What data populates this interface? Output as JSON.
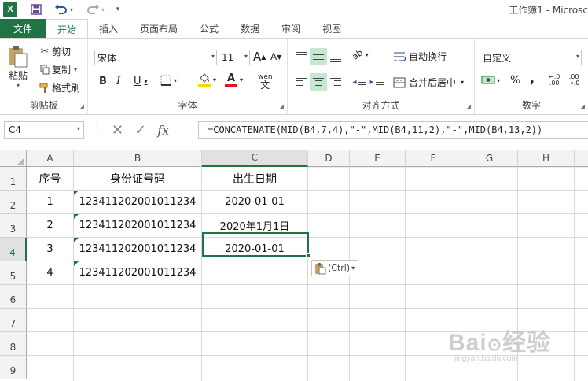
{
  "window": {
    "title": "工作簿1 - Microsc"
  },
  "quick_access": {
    "save_icon": "save-icon",
    "undo_icon": "undo-icon",
    "redo_icon": "redo-icon",
    "customize": "▾"
  },
  "tabs": [
    "文件",
    "开始",
    "插入",
    "页面布局",
    "公式",
    "数据",
    "审阅",
    "视图"
  ],
  "ribbon": {
    "clipboard": {
      "paste": "粘贴",
      "cut": "剪切",
      "copy": "复制",
      "format_painter": "格式刷",
      "label": "剪贴板"
    },
    "font": {
      "name": "宋体",
      "size": "11",
      "bold": "B",
      "italic": "I",
      "underline": "U",
      "grow": "A",
      "shrink": "A",
      "phonetic": "wén",
      "label": "字体"
    },
    "alignment": {
      "wrap": "自动换行",
      "merge": "合并后居中",
      "label": "对齐方式"
    },
    "number": {
      "format": "自定义",
      "percent": "%",
      "comma": ",",
      "inc_decimal": "←.0\n.00",
      "dec_decimal": ".00\n→.0",
      "label": "数字"
    }
  },
  "formula_bar": {
    "name_box": "C4",
    "formula": "=CONCATENATE(MID(B4,7,4),\"-\",MID(B4,11,2),\"-\",MID(B4,13,2))"
  },
  "sheet": {
    "columns": [
      "A",
      "B",
      "C",
      "D",
      "E",
      "F",
      "G",
      "H"
    ],
    "rows": [
      "1",
      "2",
      "3",
      "4",
      "5",
      "6",
      "7",
      "8",
      "9"
    ],
    "cells": [
      [
        "序号",
        "身份证号码",
        "出生日期"
      ],
      [
        "1",
        "123411202001011234",
        "2020-01-01"
      ],
      [
        "2",
        "123411202001011234",
        "2020年1月1日"
      ],
      [
        "3",
        "123411202001011234",
        "2020-01-01"
      ],
      [
        "4",
        "123411202001011234",
        ""
      ]
    ],
    "active_cell": "C4"
  },
  "paste_options": {
    "label": "(Ctrl)"
  },
  "watermark": {
    "logo": "Bai经验",
    "url": "jingyan.baidu.com"
  },
  "colors": {
    "accent": "#217346",
    "selected_fill": "#c6e7d1",
    "font_color": "#e81123",
    "highlight": "#ffd700"
  }
}
